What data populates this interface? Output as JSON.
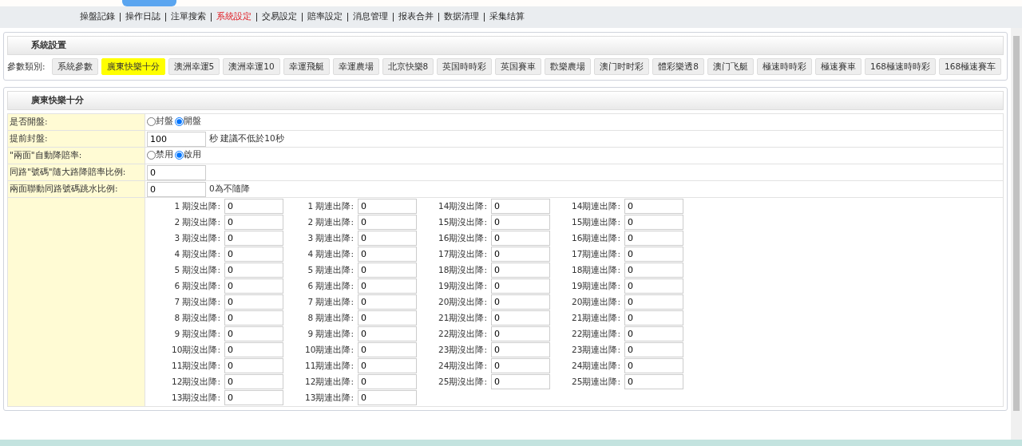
{
  "nav": [
    {
      "label": "操盤記錄",
      "selected": false
    },
    {
      "label": "操作日誌",
      "selected": false
    },
    {
      "label": "注單搜索",
      "selected": false
    },
    {
      "label": "系統設定",
      "selected": true
    },
    {
      "label": "交易設定",
      "selected": false
    },
    {
      "label": "賠率設定",
      "selected": false
    },
    {
      "label": "消息管理",
      "selected": false
    },
    {
      "label": "报表合并",
      "selected": false
    },
    {
      "label": "数据清理",
      "selected": false
    },
    {
      "label": "采集结算",
      "selected": false
    }
  ],
  "system_panel": {
    "title": "系統設置",
    "category_label": "參數類別:",
    "categories": [
      {
        "label": "系統參數",
        "selected": false
      },
      {
        "label": "廣東快樂十分",
        "selected": true
      },
      {
        "label": "澳洲幸運5",
        "selected": false
      },
      {
        "label": "澳洲幸運10",
        "selected": false
      },
      {
        "label": "幸運飛艇",
        "selected": false
      },
      {
        "label": "幸運農場",
        "selected": false
      },
      {
        "label": "北京快樂8",
        "selected": false
      },
      {
        "label": "英国時時彩",
        "selected": false
      },
      {
        "label": "英国賽車",
        "selected": false
      },
      {
        "label": "歡樂農場",
        "selected": false
      },
      {
        "label": "澳门时时彩",
        "selected": false
      },
      {
        "label": "體彩樂透8",
        "selected": false
      },
      {
        "label": "澳门飞艇",
        "selected": false
      },
      {
        "label": "極速時時彩",
        "selected": false
      },
      {
        "label": "極速賽車",
        "selected": false
      },
      {
        "label": "168極速時時彩",
        "selected": false
      },
      {
        "label": "168極速賽车",
        "selected": false
      }
    ]
  },
  "game_panel": {
    "title": "廣東快樂十分",
    "settings": [
      {
        "kind": "radio",
        "label": "是否開盤:",
        "options": [
          {
            "label": "封盤",
            "selected": false
          },
          {
            "label": "開盤",
            "selected": true
          }
        ]
      },
      {
        "kind": "input",
        "label": "提前封盤:",
        "value": "100",
        "note": "秒 建議不低於10秒"
      },
      {
        "kind": "radio",
        "label": "\"兩面\"自動降賠率:",
        "options": [
          {
            "label": "禁用",
            "selected": false
          },
          {
            "label": "啟用",
            "selected": true
          }
        ]
      },
      {
        "kind": "input",
        "label": "同路\"號碼\"隨大路降賠率比例:",
        "value": "0"
      },
      {
        "kind": "input",
        "label": "兩面聯動同路號碼跳水比例:",
        "value": "0",
        "note": "0為不隨降"
      }
    ],
    "drop_columns": [
      {
        "items": [
          {
            "label": "1 期沒出降:",
            "value": "0"
          },
          {
            "label": "2 期沒出降:",
            "value": "0"
          },
          {
            "label": "3 期沒出降:",
            "value": "0"
          },
          {
            "label": "4 期沒出降:",
            "value": "0"
          },
          {
            "label": "5 期沒出降:",
            "value": "0"
          },
          {
            "label": "6 期沒出降:",
            "value": "0"
          },
          {
            "label": "7 期沒出降:",
            "value": "0"
          },
          {
            "label": "8 期沒出降:",
            "value": "0"
          },
          {
            "label": "9 期沒出降:",
            "value": "0"
          },
          {
            "label": "10期沒出降:",
            "value": "0"
          },
          {
            "label": "11期沒出降:",
            "value": "0"
          },
          {
            "label": "12期沒出降:",
            "value": "0"
          },
          {
            "label": "13期沒出降:",
            "value": "0"
          }
        ]
      },
      {
        "items": [
          {
            "label": "1 期連出降:",
            "value": "0"
          },
          {
            "label": "2 期連出降:",
            "value": "0"
          },
          {
            "label": "3 期連出降:",
            "value": "0"
          },
          {
            "label": "4 期連出降:",
            "value": "0"
          },
          {
            "label": "5 期連出降:",
            "value": "0"
          },
          {
            "label": "6 期連出降:",
            "value": "0"
          },
          {
            "label": "7 期連出降:",
            "value": "0"
          },
          {
            "label": "8 期連出降:",
            "value": "0"
          },
          {
            "label": "9 期連出降:",
            "value": "0"
          },
          {
            "label": "10期連出降:",
            "value": "0"
          },
          {
            "label": "11期連出降:",
            "value": "0"
          },
          {
            "label": "12期連出降:",
            "value": "0"
          },
          {
            "label": "13期連出降:",
            "value": "0"
          }
        ]
      },
      {
        "items": [
          {
            "label": "14期沒出降:",
            "value": "0"
          },
          {
            "label": "15期沒出降:",
            "value": "0"
          },
          {
            "label": "16期沒出降:",
            "value": "0"
          },
          {
            "label": "17期沒出降:",
            "value": "0"
          },
          {
            "label": "18期沒出降:",
            "value": "0"
          },
          {
            "label": "19期沒出降:",
            "value": "0"
          },
          {
            "label": "20期沒出降:",
            "value": "0"
          },
          {
            "label": "21期沒出降:",
            "value": "0"
          },
          {
            "label": "22期沒出降:",
            "value": "0"
          },
          {
            "label": "23期沒出降:",
            "value": "0"
          },
          {
            "label": "24期沒出降:",
            "value": "0"
          },
          {
            "label": "25期沒出降:",
            "value": "0"
          }
        ]
      },
      {
        "items": [
          {
            "label": "14期連出降:",
            "value": "0"
          },
          {
            "label": "15期連出降:",
            "value": "0"
          },
          {
            "label": "16期連出降:",
            "value": "0"
          },
          {
            "label": "17期連出降:",
            "value": "0"
          },
          {
            "label": "18期連出降:",
            "value": "0"
          },
          {
            "label": "19期連出降:",
            "value": "0"
          },
          {
            "label": "20期連出降:",
            "value": "0"
          },
          {
            "label": "21期連出降:",
            "value": "0"
          },
          {
            "label": "22期連出降:",
            "value": "0"
          },
          {
            "label": "23期連出降:",
            "value": "0"
          },
          {
            "label": "24期連出降:",
            "value": "0"
          },
          {
            "label": "25期連出降:",
            "value": "0"
          }
        ]
      }
    ]
  }
}
